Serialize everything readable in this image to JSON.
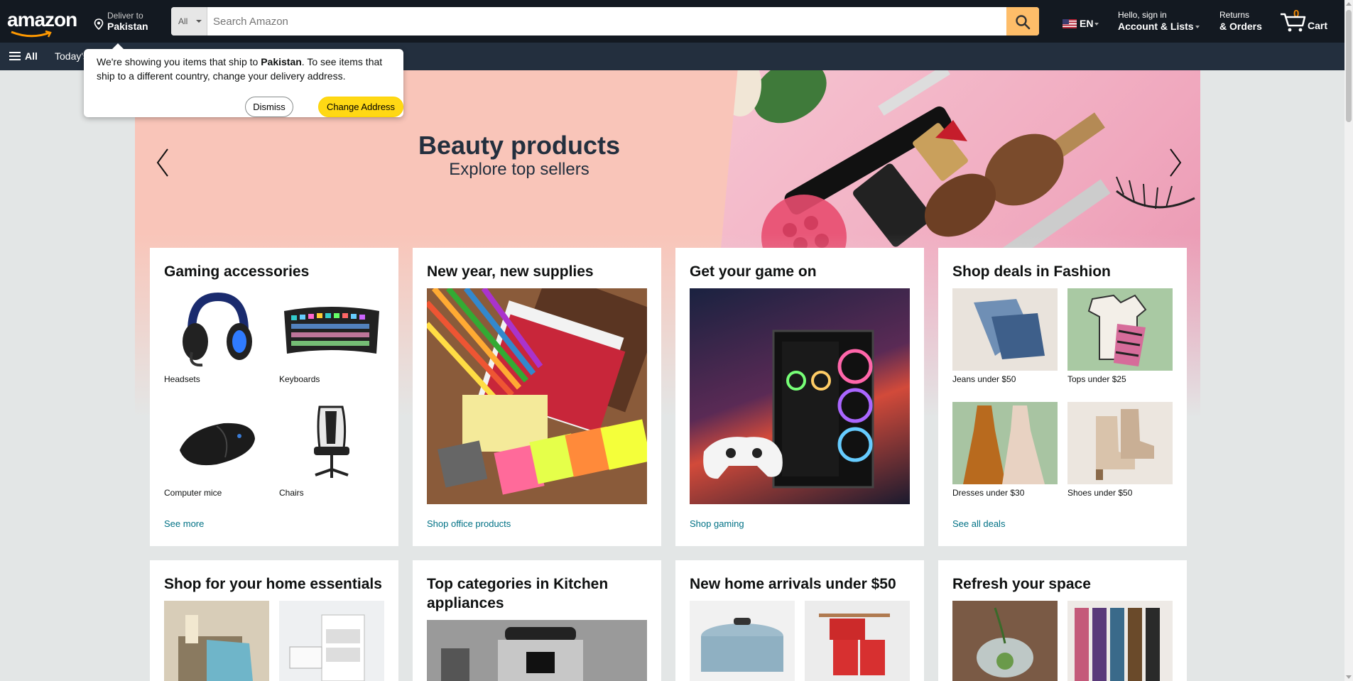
{
  "nav": {
    "logo": "amazon",
    "deliver_line1": "Deliver to",
    "deliver_line2": "Pakistan",
    "search_category": "All",
    "search_placeholder": "Search Amazon",
    "language": "EN",
    "account_line1": "Hello, sign in",
    "account_line2": "Account & Lists",
    "returns_line1": "Returns",
    "returns_line2": "& Orders",
    "cart_count": "0",
    "cart_label": "Cart",
    "all_label": "All",
    "today_label": "Today's Deals"
  },
  "popover": {
    "text_before": "We're showing you items that ship to ",
    "country": "Pakistan",
    "text_after": ". To see items that ship to a different country, change your delivery address.",
    "dismiss": "Dismiss",
    "change": "Change Address"
  },
  "hero": {
    "title": "Beauty products",
    "subtitle": "Explore top sellers"
  },
  "cards": [
    {
      "title": "Gaming accessories",
      "items": [
        "Headsets",
        "Keyboards",
        "Computer mice",
        "Chairs"
      ],
      "link": "See more"
    },
    {
      "title": "New year, new supplies",
      "link": "Shop office products"
    },
    {
      "title": "Get your game on",
      "link": "Shop gaming"
    },
    {
      "title": "Shop deals in Fashion",
      "items": [
        "Jeans under $50",
        "Tops under $25",
        "Dresses under $30",
        "Shoes under $50"
      ],
      "link": "See all deals"
    },
    {
      "title": "Shop for your home essentials"
    },
    {
      "title": "Top categories in Kitchen appliances"
    },
    {
      "title": "New home arrivals under $50"
    },
    {
      "title": "Refresh your space"
    }
  ],
  "colors": {
    "nav_bg": "#131921",
    "subnav_bg": "#232f3e",
    "search_btn": "#febd69",
    "cart_count": "#f08804",
    "link": "#007185",
    "change_btn": "#ffd814",
    "hero_bg": "#f9c5b9"
  }
}
